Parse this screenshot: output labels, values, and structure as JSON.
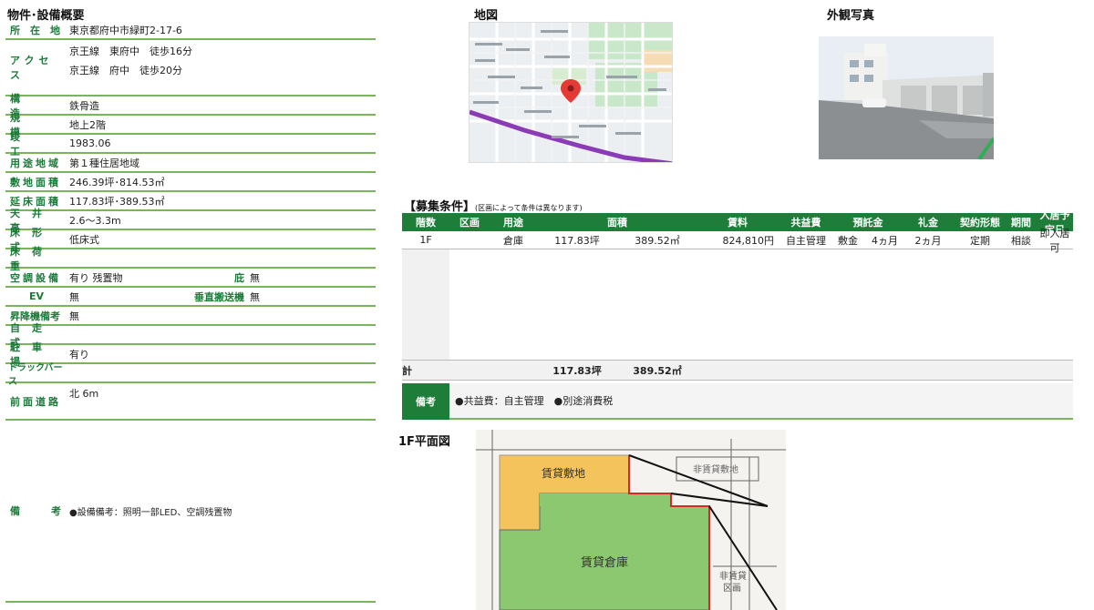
{
  "left": {
    "title": "物件･設備概要",
    "rows": {
      "location": {
        "label": "所　在　地",
        "value": "東京都府中市緑町2-17-6"
      },
      "access": {
        "label": "アクセス",
        "value1": "京王線　東府中　徒歩16分",
        "value2": "京王線　府中　徒歩20分"
      },
      "structure": {
        "label": "構造",
        "value": "鉄骨造"
      },
      "scale": {
        "label": "規模",
        "value": "地上2階"
      },
      "completion": {
        "label": "竣工",
        "value": "1983.06"
      },
      "zoning": {
        "label": "用途地域",
        "value": "第１種住居地域"
      },
      "site_area": {
        "label": "敷地面積",
        "value": "246.39坪･814.53㎡"
      },
      "floor_area": {
        "label": "延床面積",
        "value": "117.83坪･389.53㎡"
      },
      "ceiling": {
        "label": "天井高",
        "value": "2.6～3.3m"
      },
      "floor_type": {
        "label": "床形式",
        "value": "低床式"
      },
      "floor_load": {
        "label": "床荷重",
        "value": ""
      },
      "aircon": {
        "label": "空調設備",
        "value": "有り 残置物",
        "label2": "庇",
        "value2": "無"
      },
      "ev": {
        "label": "EV",
        "value": "無",
        "label2": "垂直搬送機",
        "value2": "無"
      },
      "lift_note": {
        "label": "昇降機備考",
        "value": "無"
      },
      "self_drive": {
        "label": "自走式",
        "value": ""
      },
      "parking": {
        "label": "駐車場",
        "value": "有り"
      },
      "truck_berth": {
        "label": "トラックバース",
        "value": ""
      },
      "front_road": {
        "label": "前面道路",
        "value": "北 6m"
      },
      "remarks": {
        "label": "備　　考",
        "value": "●設備備考：照明一部LED、空調残置物"
      }
    }
  },
  "map": {
    "title": "地図"
  },
  "photo": {
    "title": "外観写真"
  },
  "conditions": {
    "title": "【募集条件】",
    "note": "(区画によって条件は異なります)",
    "headers": {
      "floor": "階数",
      "section": "区画",
      "use": "用途",
      "area": "面積",
      "rent": "賃料",
      "common": "共益費",
      "deposit": "預託金",
      "key": "礼金",
      "contract": "契約形態",
      "period": "期間",
      "move": "入居予定日"
    },
    "row": {
      "floor": "1F",
      "section": "",
      "use": "倉庫",
      "area_tsubo": "117.83坪",
      "area_sqm": "389.52㎡",
      "rent": "824,810円",
      "common": "自主管理",
      "deposit_label": "敷金",
      "deposit": "4ヵ月",
      "key": "2ヵ月",
      "contract": "定期",
      "period": "相談",
      "move": "即入居可"
    },
    "total": {
      "label": "計",
      "tsubo": "117.83坪",
      "sqm": "389.52㎡"
    },
    "remarks": {
      "label": "備考",
      "value": "●共益費：自主管理　●別途消費税"
    }
  },
  "plan": {
    "title": "1F平面図",
    "label_rental_site": "賃貸敷地",
    "label_non_rental_site": "非賃貸敷地",
    "label_warehouse": "賃貸倉庫",
    "label_non_rental_section_1": "非賃貸",
    "label_non_rental_section_2": "区画"
  },
  "colors": {
    "accent_green": "#1e7d39",
    "label_green": "#1d7a3a",
    "divider": "#7ab55c"
  }
}
